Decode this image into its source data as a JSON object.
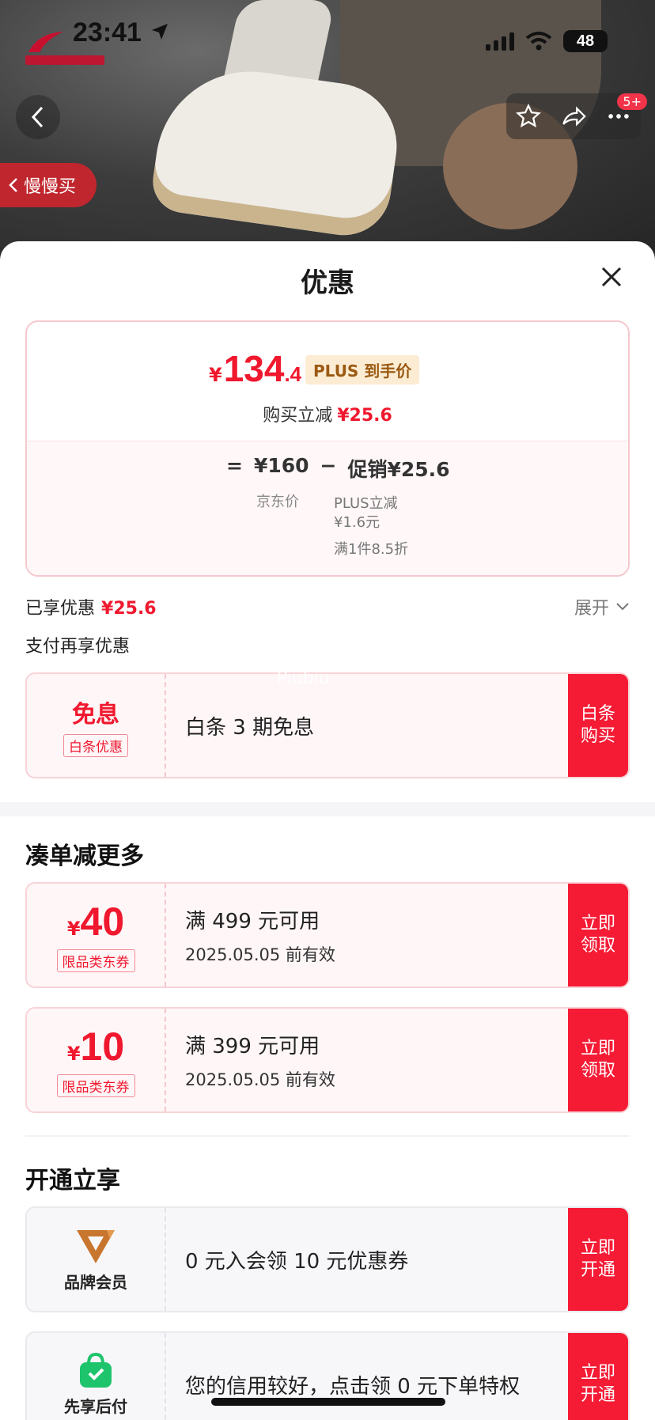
{
  "status_bar": {
    "time": "23:41",
    "battery": "48"
  },
  "header": {
    "badge": "5+",
    "slow_buy": "慢慢买"
  },
  "sheet": {
    "title": "优惠",
    "price": {
      "yen": "¥",
      "integer": "134",
      "decimal": ".4",
      "plus_tag": "PLUS 到手价",
      "reduce_label": "购买立减",
      "reduce_value": "¥25.6",
      "equals": "=",
      "jd_price": "¥160",
      "minus": "−",
      "promo": "促销¥25.6",
      "jd_price_label": "京东价",
      "plus_reduce_line1": "PLUS立减",
      "plus_reduce_line2": "¥1.6元",
      "discount_rule": "满1件8.5折"
    },
    "enjoyed_label": "已享优惠",
    "enjoyed_value": "¥25.6",
    "expand_label": "展开",
    "pay_more_label": "支付再享优惠",
    "watermark": "Piubiu",
    "baitiao": {
      "title": "免息",
      "tag": "白条优惠",
      "desc": "白条 3 期免息",
      "cta": "白条购买"
    },
    "more_section_title": "凑单减更多",
    "coupons": [
      {
        "yen": "¥",
        "amount": "40",
        "tag": "限品类东券",
        "condition": "满 499 元可用",
        "expiry": "2025.05.05 前有效",
        "cta": "立即领取"
      },
      {
        "yen": "¥",
        "amount": "10",
        "tag": "限品类东券",
        "condition": "满 399 元可用",
        "expiry": "2025.05.05 前有效",
        "cta": "立即领取"
      }
    ],
    "open_section_title": "开通立享",
    "member": {
      "label": "品牌会员",
      "desc": "0 元入会领 10 元优惠券",
      "cta": "立即开通"
    },
    "paylater": {
      "label": "先享后付",
      "desc": "您的信用较好，点击领 0 元下单特权",
      "cta": "立即开通"
    }
  },
  "colors": {
    "accent_red": "#f51b35",
    "price_red": "#f0182e",
    "plus_gold": "#9a5a12"
  }
}
